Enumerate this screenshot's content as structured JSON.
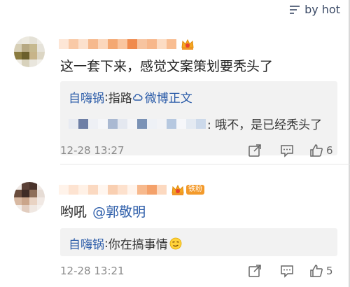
{
  "sort": {
    "label": "by hot",
    "icon": "sort-lines-icon"
  },
  "comments": [
    {
      "text": "这一套下来，感觉文案策划要秃头了",
      "timestamp": "12-28 13:27",
      "likes": "6",
      "reply": {
        "author": "自嗨锅",
        "separator": ": ",
        "body_prefix": "指路",
        "link_label": "微博正文",
        "second_line_body": ": 哦不，是已经秃头了"
      }
    },
    {
      "text": "哟吼",
      "mention": "@郭敬明",
      "badge_label": "铁粉",
      "timestamp": "12-28 13:21",
      "likes": "5",
      "reply": {
        "author": "自嗨锅",
        "separator": ": ",
        "body": "你在搞事情"
      }
    }
  ],
  "colors": {
    "link": "#2a5ba8",
    "reply_bg": "#f2f2f2",
    "timestamp": "#8a8a8a",
    "badge": "#f39a2b"
  }
}
